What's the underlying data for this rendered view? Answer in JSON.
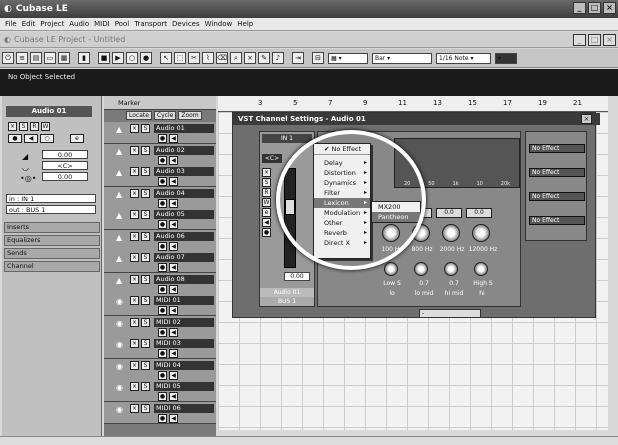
{
  "app": {
    "title": "Cubase LE"
  },
  "menus": [
    "File",
    "Edit",
    "Project",
    "Audio",
    "MIDI",
    "Pool",
    "Transport",
    "Devices",
    "Window",
    "Help"
  ],
  "project": {
    "title": "Cubase LE Project - Untitled"
  },
  "toolbar": {
    "quantize": "Bar",
    "grid": "1/16 Note"
  },
  "info": {
    "status": "No Object Selected"
  },
  "inspector": {
    "track": "Audio 01",
    "volume": "0.00",
    "pan": "<C>",
    "delay": "0.00",
    "input": "in : IN 1",
    "output": "out : BUS 1",
    "sections": [
      "Inserts",
      "Equalizers",
      "Sends",
      "Channel"
    ]
  },
  "tracklist": {
    "marker": "Marker",
    "locate": "Locate",
    "cycle": "Cycle",
    "zoom": "Zoom",
    "tracks": [
      "Audio 01",
      "Audio 02",
      "Audio 03",
      "Audio 04",
      "Audio 05",
      "Audio 06",
      "Audio 07",
      "Audio 08",
      "MIDI 01",
      "MIDI 02",
      "MIDI 03",
      "MIDI 04",
      "MIDI 05",
      "MIDI 06"
    ]
  },
  "ruler": {
    "marks": [
      "3",
      "5",
      "7",
      "9",
      "11",
      "13",
      "15",
      "17",
      "19",
      "21"
    ]
  },
  "vst": {
    "title": "VST Channel Settings - Audio 01",
    "input": "IN 1",
    "pan": "<C>",
    "level": "0.00",
    "channel_name": "Audio 01",
    "bus": "BUS 1",
    "effects": [
      "No Effect",
      "No Effect",
      "No Effect",
      "No Effect"
    ],
    "eq_gains": [
      "0.0",
      "0.0",
      "0.0"
    ],
    "eq_freqs": [
      "800 Hz",
      "2000 Hz",
      "12000 Hz"
    ],
    "eq_low_freq": "100 Hz",
    "eq_q": [
      "0.7",
      "0.7"
    ],
    "eq_bands": [
      "Low S",
      "lo mid",
      "hi mid",
      "High S"
    ],
    "eq_band_names": [
      "lo",
      "lo mid",
      "hi mid",
      "hi"
    ],
    "graph_ticks": [
      "20",
      "50",
      "1k",
      "10",
      "20k"
    ]
  },
  "effect_menu": {
    "items": [
      "No Effect",
      "Delay",
      "Distortion",
      "Dynamics",
      "Filter",
      "Lexicon",
      "Modulation",
      "Other",
      "Reverb",
      "Direct X"
    ],
    "selected": "Lexicon",
    "submenu": [
      "MX200",
      "Pantheon"
    ]
  }
}
